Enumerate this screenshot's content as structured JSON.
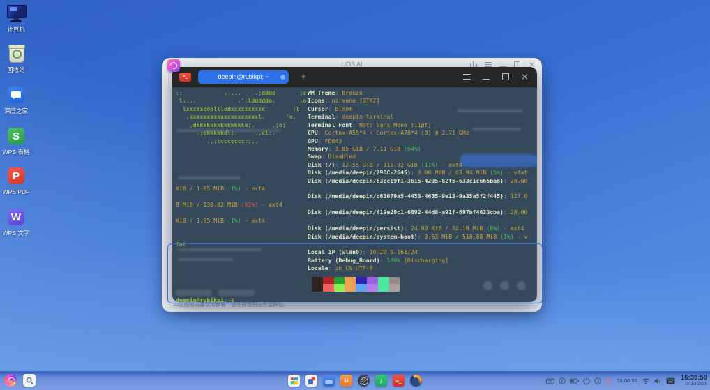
{
  "desktop": {
    "icons": [
      {
        "label": "计算机",
        "kind": "computer"
      },
      {
        "label": "回收站",
        "kind": "trash"
      },
      {
        "label": "深度之家",
        "kind": "deepin-home"
      },
      {
        "label": "WPS 表格",
        "kind": "wps-sheet",
        "letter": "S",
        "color": "#35ad53"
      },
      {
        "label": "WPS PDF",
        "kind": "wps-pdf",
        "letter": "P",
        "color": "#e8473b"
      },
      {
        "label": "WPS 文字",
        "kind": "wps-writer",
        "letter": "W",
        "color": "#6c5ce7"
      }
    ]
  },
  "ai_window": {
    "title": "UOS AI",
    "disclaimer": "AI生成的内容仅供参考，请注意甄别信息准确性。"
  },
  "terminal": {
    "tab_title": "deepin@rubikpi: ~",
    "new_tab_label": "+",
    "rows": [
      {
        "row": 0,
        "side": "left",
        "seg": [
          {
            "t": "::            .....    .;dddo       ;c",
            "c": "art"
          }
        ]
      },
      {
        "row": 1,
        "side": "left",
        "seg": [
          {
            "t": " l:...            .';ldddddo.       ,o",
            "c": "art"
          }
        ]
      },
      {
        "row": 2,
        "side": "left",
        "seg": [
          {
            "t": "  lxxxxxdoolllodxxxxxxxxxc        :l",
            "c": "art"
          }
        ]
      },
      {
        "row": 3,
        "side": "left",
        "seg": [
          {
            "t": "   ,dxxxxxxxxxxxxxxxxxxxl.      'o,",
            "c": "art"
          }
        ]
      },
      {
        "row": 4,
        "side": "left",
        "seg": [
          {
            "t": "    ,dkkkkkkkkkkkkkko;.     .;o;",
            "c": "art"
          }
        ]
      },
      {
        "row": 5,
        "side": "left",
        "seg": [
          {
            "t": "      .;okkkkkdl;.     .,cl:.",
            "c": "art"
          }
        ]
      },
      {
        "row": 6,
        "side": "left",
        "seg": [
          {
            "t": "         .,;cccccccc:;,.",
            "c": "art"
          }
        ]
      },
      {
        "row": 0,
        "side": "info",
        "seg": [
          {
            "t": "WM Theme",
            "c": "lab"
          },
          {
            "t": ": ",
            "c": "pun"
          },
          {
            "t": "Breeze",
            "c": "val"
          }
        ]
      },
      {
        "row": 1,
        "side": "info",
        "seg": [
          {
            "t": "Icons",
            "c": "lab"
          },
          {
            "t": ": ",
            "c": "pun"
          },
          {
            "t": "nirvana [GTK2]",
            "c": "val"
          }
        ]
      },
      {
        "row": 2,
        "side": "info",
        "seg": [
          {
            "t": "Cursor",
            "c": "lab"
          },
          {
            "t": ": ",
            "c": "pun"
          },
          {
            "t": "bloom",
            "c": "val"
          }
        ]
      },
      {
        "row": 3,
        "side": "info",
        "seg": [
          {
            "t": "Terminal",
            "c": "lab"
          },
          {
            "t": ": ",
            "c": "pun"
          },
          {
            "t": "deepin-terminal",
            "c": "val"
          }
        ]
      },
      {
        "row": 4,
        "side": "info",
        "seg": [
          {
            "t": "Terminal Font",
            "c": "lab"
          },
          {
            "t": ": ",
            "c": "pun"
          },
          {
            "t": "Noto Sans Mono (11pt)",
            "c": "val"
          }
        ]
      },
      {
        "row": 5,
        "side": "info",
        "seg": [
          {
            "t": "CPU",
            "c": "lab"
          },
          {
            "t": ": ",
            "c": "pun"
          },
          {
            "t": "Cortex-A55*4 + Cortex-A78*4 (8) @ 2.71 GHz",
            "c": "val"
          }
        ]
      },
      {
        "row": 6,
        "side": "info",
        "seg": [
          {
            "t": "GPU",
            "c": "lab"
          },
          {
            "t": ": ",
            "c": "pun"
          },
          {
            "t": "FD643",
            "c": "val"
          }
        ]
      },
      {
        "row": 7,
        "side": "info",
        "seg": [
          {
            "t": "Memory",
            "c": "lab"
          },
          {
            "t": ": ",
            "c": "pun"
          },
          {
            "t": "3.85 GiB / 7.11 GiB ",
            "c": "val"
          },
          {
            "t": "(54%)",
            "c": "ok"
          }
        ]
      },
      {
        "row": 8,
        "side": "info",
        "seg": [
          {
            "t": "Swap",
            "c": "lab"
          },
          {
            "t": ": ",
            "c": "pun"
          },
          {
            "t": "Disabled",
            "c": "val"
          }
        ]
      },
      {
        "row": 9,
        "side": "info",
        "seg": [
          {
            "t": "Disk (/)",
            "c": "lab"
          },
          {
            "t": ": ",
            "c": "pun"
          },
          {
            "t": "12.55 GiB / 111.92 GiB ",
            "c": "val"
          },
          {
            "t": "(11%)",
            "c": "ok"
          },
          {
            "t": " - ext4",
            "c": "val"
          }
        ]
      },
      {
        "row": 10,
        "side": "info",
        "seg": [
          {
            "t": "Disk (/media/deepin/29DC-2645)",
            "c": "lab"
          },
          {
            "t": ": ",
            "c": "pun"
          },
          {
            "t": "3.00 MiB / 63.94 MiB ",
            "c": "val"
          },
          {
            "t": "(5%)",
            "c": "ok"
          },
          {
            "t": " - vfat",
            "c": "val"
          }
        ]
      },
      {
        "row": 11,
        "side": "info",
        "seg": [
          {
            "t": "Disk (/media/deepin/63cc19f1-3615-4295-82f5-633c1c665ba6)",
            "c": "lab"
          },
          {
            "t": ": ",
            "c": "pun"
          },
          {
            "t": "28.00",
            "c": "val"
          }
        ]
      },
      {
        "row": 12,
        "side": "left",
        "seg": [
          {
            "t": "KiB / 1.95 MiB ",
            "c": "val"
          },
          {
            "t": "(1%)",
            "c": "ok"
          },
          {
            "t": " - ext4",
            "c": "val"
          }
        ]
      },
      {
        "row": 13,
        "side": "info",
        "seg": [
          {
            "t": "Disk (/media/deepin/c61079a5-4453-4635-9e13-9a35a5f2f445)",
            "c": "lab"
          },
          {
            "t": ": ",
            "c": "pun"
          },
          {
            "t": "127.0",
            "c": "val"
          }
        ]
      },
      {
        "row": 14,
        "side": "left",
        "seg": [
          {
            "t": "8 MiB / 138.82 MiB ",
            "c": "val"
          },
          {
            "t": "(92%)",
            "c": "bad"
          },
          {
            "t": " - ext4",
            "c": "val"
          }
        ]
      },
      {
        "row": 15,
        "side": "info",
        "seg": [
          {
            "t": "Disk (/media/deepin/f19e29c1-6892-44d8-a91f-697bf4633cba)",
            "c": "lab"
          },
          {
            "t": ": ",
            "c": "pun"
          },
          {
            "t": "28.00",
            "c": "val"
          }
        ]
      },
      {
        "row": 16,
        "side": "left",
        "seg": [
          {
            "t": "KiB / 1.95 MiB ",
            "c": "val"
          },
          {
            "t": "(1%)",
            "c": "ok"
          },
          {
            "t": " - ext4",
            "c": "val"
          }
        ]
      },
      {
        "row": 17,
        "side": "info",
        "seg": [
          {
            "t": "Disk (/media/deepin/persist)",
            "c": "lab"
          },
          {
            "t": ": ",
            "c": "pun"
          },
          {
            "t": "24.00 KiB / 24.10 MiB ",
            "c": "val"
          },
          {
            "t": "(0%)",
            "c": "ok"
          },
          {
            "t": " - ext4",
            "c": "val"
          }
        ]
      },
      {
        "row": 18,
        "side": "info",
        "seg": [
          {
            "t": "Disk (/media/deepin/system-boot)",
            "c": "lab"
          },
          {
            "t": ": ",
            "c": "pun"
          },
          {
            "t": "3.63 MiB / 510.88 MiB ",
            "c": "val"
          },
          {
            "t": "(1%)",
            "c": "ok"
          },
          {
            "t": " - v",
            "c": "val"
          }
        ]
      },
      {
        "row": 19,
        "side": "left",
        "seg": [
          {
            "t": "fat",
            "c": "val"
          }
        ]
      },
      {
        "row": 20,
        "side": "info",
        "seg": [
          {
            "t": "Local IP (wlan0)",
            "c": "lab"
          },
          {
            "t": ": ",
            "c": "pun"
          },
          {
            "t": "10.20.9.161/24",
            "c": "val"
          }
        ]
      },
      {
        "row": 21,
        "side": "info",
        "seg": [
          {
            "t": "Battery (Debug_Board)",
            "c": "lab"
          },
          {
            "t": ": ",
            "c": "pun"
          },
          {
            "t": "100%",
            "c": "ok"
          },
          {
            "t": " [Discharging]",
            "c": "val"
          }
        ]
      },
      {
        "row": 22,
        "side": "info",
        "seg": [
          {
            "t": "Locale",
            "c": "lab"
          },
          {
            "t": ": ",
            "c": "pun"
          },
          {
            "t": "zh_CN.UTF-8",
            "c": "val"
          }
        ]
      },
      {
        "row": 26,
        "side": "left",
        "seg": [
          {
            "t": "deepin@rubikpi",
            "c": "user"
          },
          {
            "t": ":",
            "c": "pun"
          },
          {
            "t": "~",
            "c": "path"
          },
          {
            "t": "$",
            "c": "sym"
          }
        ]
      }
    ],
    "palette": [
      [
        "#2d2220",
        "#b22424",
        "#1fa332",
        "#f0a052",
        "#2824b2",
        "#9e5fe0",
        "#49e89c",
        "#98898a"
      ],
      [
        "#2d2220",
        "#f05f5f",
        "#8df052",
        "#f0a052",
        "#5fa4f0",
        "#b37df0",
        "#49e89c",
        "#aa9f9f"
      ]
    ]
  },
  "taskbar": {
    "app_icons": [
      "launcher",
      "search",
      "app-grid",
      "security-center",
      "file-manager",
      "app-store",
      "control-center",
      "music",
      "terminal",
      "firefox"
    ],
    "tray": {
      "recording_timer": "00:00:32",
      "time": "16:39:50",
      "date": "10 Jul 2025"
    }
  }
}
